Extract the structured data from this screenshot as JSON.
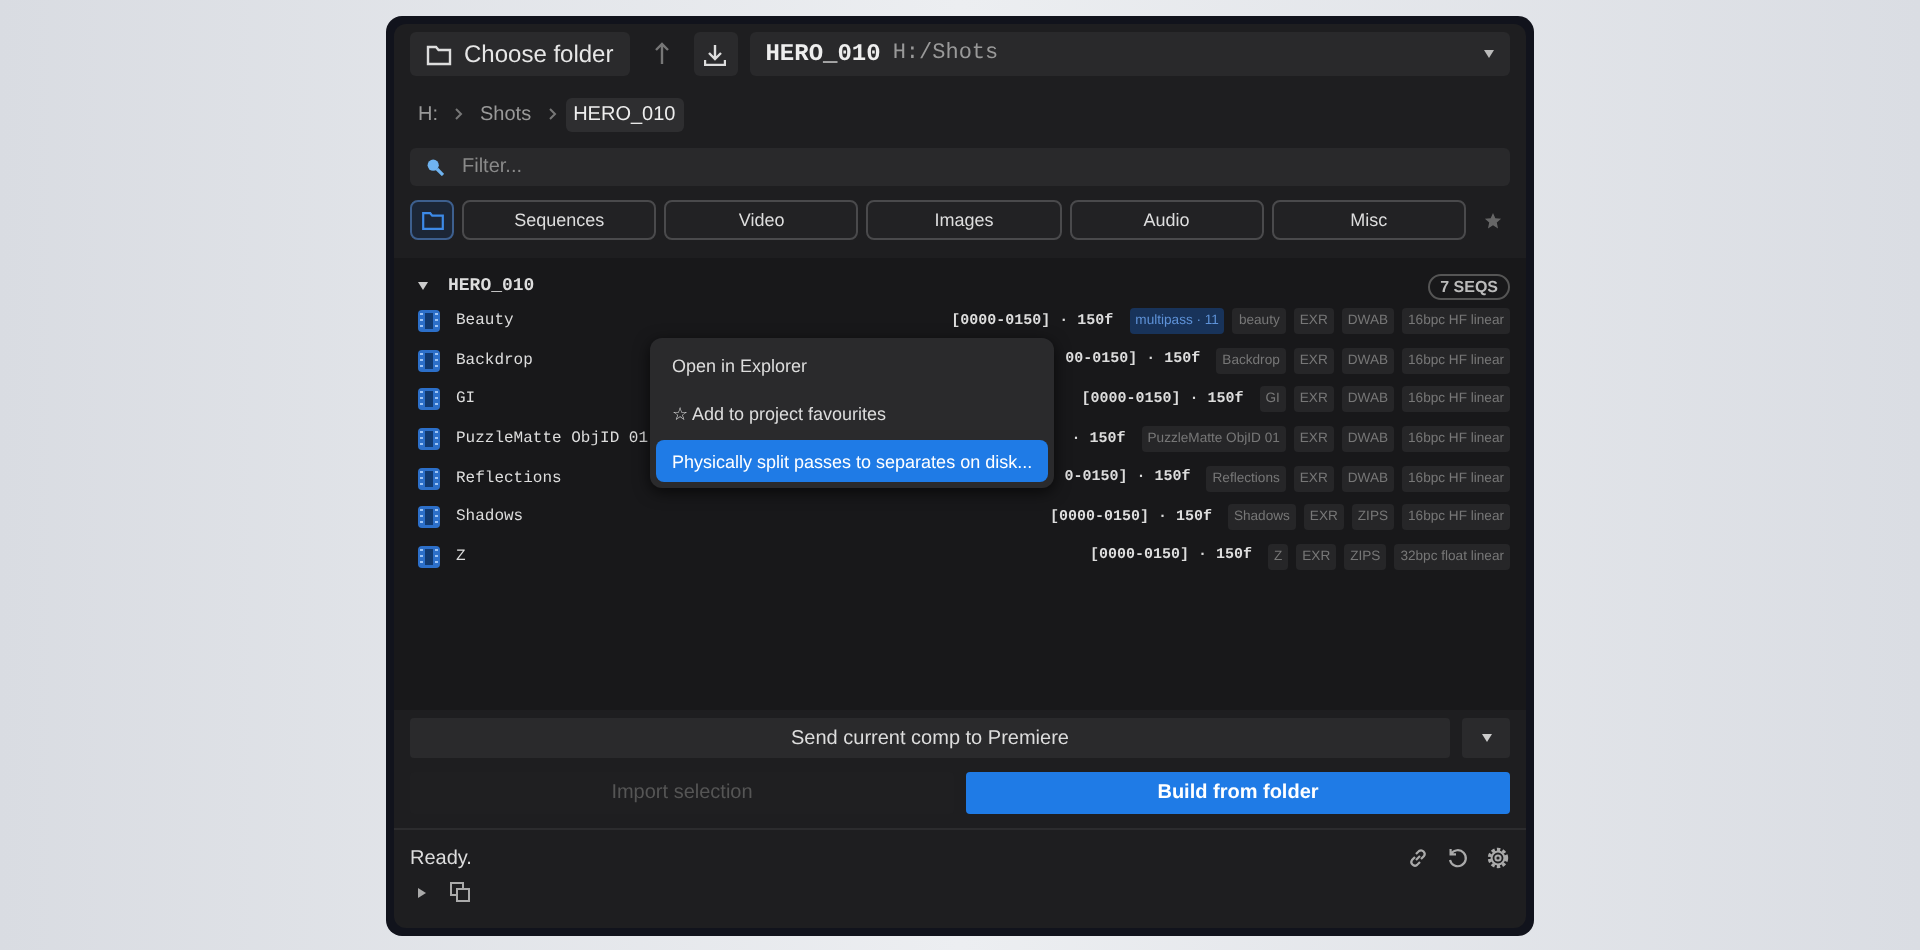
{
  "toolbar": {
    "choose_folder": "Choose folder",
    "path_name": "HERO_010",
    "path_location": "H:/Shots"
  },
  "breadcrumb": [
    {
      "label": "H:",
      "selected": false
    },
    {
      "label": "Shots",
      "selected": false
    },
    {
      "label": "HERO_010",
      "selected": true
    }
  ],
  "filter": {
    "placeholder": "Filter..."
  },
  "folder_toggle": {
    "selected": true
  },
  "filters": [
    {
      "label": "Sequences",
      "selected": false
    },
    {
      "label": "Video",
      "selected": false
    },
    {
      "label": "Images",
      "selected": false
    },
    {
      "label": "Audio",
      "selected": false
    },
    {
      "label": "Misc",
      "selected": false
    }
  ],
  "group": {
    "name": "HERO_010",
    "expanded": true,
    "count": "7 SEQS"
  },
  "rows": [
    {
      "name": "Beauty",
      "range": "[0000-0150] · 150f",
      "tags": [
        {
          "label": "multipass · 11",
          "kind": "pass"
        },
        {
          "label": "beauty",
          "kind": "tag"
        },
        {
          "label": "EXR",
          "kind": "tag"
        },
        {
          "label": "DWAB",
          "kind": "tag"
        },
        {
          "label": "16bpc HF linear",
          "kind": "tag"
        }
      ]
    },
    {
      "name": "Backdrop",
      "range": "00-0150] · 150f",
      "tags": [
        {
          "label": "Backdrop",
          "kind": "tag"
        },
        {
          "label": "EXR",
          "kind": "tag"
        },
        {
          "label": "DWAB",
          "kind": "tag"
        },
        {
          "label": "16bpc HF linear",
          "kind": "tag"
        }
      ]
    },
    {
      "name": "GI",
      "range": "[0000-0150] · 150f",
      "tags": [
        {
          "label": "GI",
          "kind": "tag"
        },
        {
          "label": "EXR",
          "kind": "tag"
        },
        {
          "label": "DWAB",
          "kind": "tag"
        },
        {
          "label": "16bpc HF linear",
          "kind": "tag"
        }
      ]
    },
    {
      "name": "PuzzleMatte ObjID 01",
      "range": "· 150f",
      "tags": [
        {
          "label": "PuzzleMatte ObjID 01",
          "kind": "tag"
        },
        {
          "label": "EXR",
          "kind": "tag"
        },
        {
          "label": "DWAB",
          "kind": "tag"
        },
        {
          "label": "16bpc HF linear",
          "kind": "tag"
        }
      ]
    },
    {
      "name": "Reflections",
      "range": "0-0150] · 150f",
      "tags": [
        {
          "label": "Reflections",
          "kind": "tag"
        },
        {
          "label": "EXR",
          "kind": "tag"
        },
        {
          "label": "DWAB",
          "kind": "tag"
        },
        {
          "label": "16bpc HF linear",
          "kind": "tag"
        }
      ]
    },
    {
      "name": "Shadows",
      "range": "[0000-0150] · 150f",
      "tags": [
        {
          "label": "Shadows",
          "kind": "tag"
        },
        {
          "label": "EXR",
          "kind": "tag"
        },
        {
          "label": "ZIPS",
          "kind": "tag"
        },
        {
          "label": "16bpc HF linear",
          "kind": "tag"
        }
      ]
    },
    {
      "name": "Z",
      "range": "[0000-0150] · 150f",
      "tags": [
        {
          "label": "Z",
          "kind": "tag"
        },
        {
          "label": "EXR",
          "kind": "tag"
        },
        {
          "label": "ZIPS",
          "kind": "tag"
        },
        {
          "label": "32bpc float linear",
          "kind": "tag"
        }
      ]
    }
  ],
  "context_menu": [
    {
      "label": "Open in Explorer",
      "selected": false
    },
    {
      "label": "☆ Add to project favourites",
      "selected": false
    },
    {
      "label": "Physically split passes to separates on disk...",
      "selected": true
    }
  ],
  "send_button": "Send current comp to Premiere",
  "import_button": {
    "label": "Import selection",
    "disabled": true
  },
  "build_button": {
    "label": "Build from folder",
    "disabled": false
  },
  "status": "Ready."
}
